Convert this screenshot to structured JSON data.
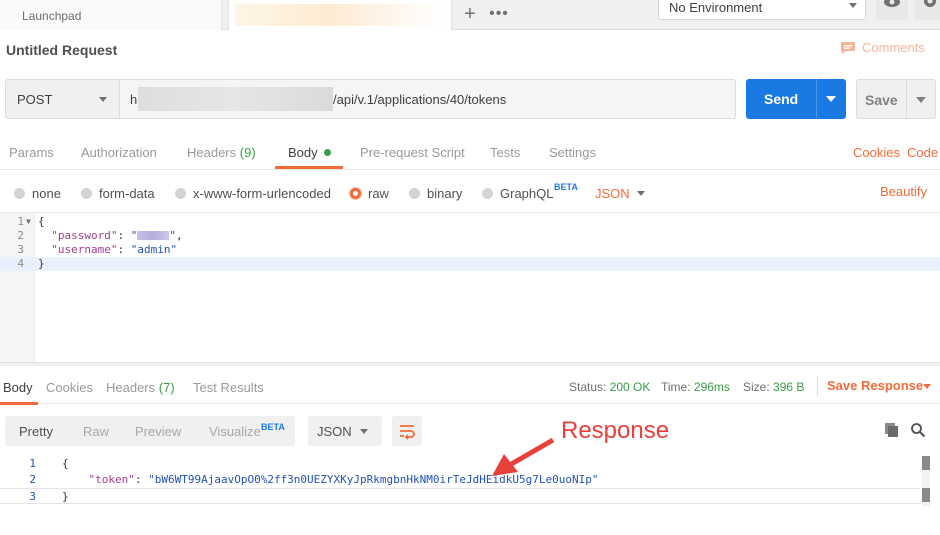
{
  "tabs": {
    "launchpad": "Launchpad",
    "add_symbol": "+",
    "more_symbol": "•••"
  },
  "environment": {
    "selected": "No Environment"
  },
  "request": {
    "title": "Untitled Request",
    "comments_label": "Comments",
    "method": "POST",
    "url_prefix": "h",
    "url_suffix": "/api/v.1/applications/40/tokens",
    "send_label": "Send",
    "save_label": "Save"
  },
  "request_tabs": [
    {
      "label": "Params"
    },
    {
      "label": "Authorization"
    },
    {
      "label": "Headers",
      "count": "(9)"
    },
    {
      "label": "Body"
    },
    {
      "label": "Pre-request Script"
    },
    {
      "label": "Tests"
    },
    {
      "label": "Settings"
    }
  ],
  "request_links": {
    "cookies": "Cookies",
    "code": "Code"
  },
  "body_types": {
    "options": [
      "none",
      "form-data",
      "x-www-form-urlencoded",
      "raw",
      "binary",
      "GraphQL"
    ],
    "selected": "raw",
    "beta": "BETA",
    "format": "JSON",
    "beautify": "Beautify"
  },
  "request_body": {
    "line_numbers": [
      "1",
      "2",
      "3",
      "4"
    ],
    "open_brace": "{",
    "password_key": "\"password\"",
    "username_key": "\"username\"",
    "username_value": "\"admin\"",
    "close_brace": "}"
  },
  "response_tabs": [
    {
      "label": "Body"
    },
    {
      "label": "Cookies"
    },
    {
      "label": "Headers",
      "count": "(7)"
    },
    {
      "label": "Test Results"
    }
  ],
  "response_status": {
    "status_label": "Status:",
    "status_value": "200 OK",
    "time_label": "Time:",
    "time_value": "296ms",
    "size_label": "Size:",
    "size_value": "396 B",
    "save_response": "Save Response"
  },
  "response_view": {
    "tabs": [
      "Pretty",
      "Raw",
      "Preview",
      "Visualize"
    ],
    "beta": "BETA",
    "format": "JSON"
  },
  "annotation": {
    "label": "Response",
    "color": "#e8403a"
  },
  "response_body": {
    "line_numbers": [
      "1",
      "2",
      "3"
    ],
    "open_brace": "{",
    "token_key": "\"token\"",
    "token_value": "\"bW6WT99AjaavOpO0%2ff3n0UEZYXKyJpRkmgbnHkNM0irTeJdHEidkU5g7Le0uoNIp\"",
    "close_brace": "}"
  },
  "colors": {
    "accent_orange": "#f26b3a",
    "send_blue": "#1a7ae3",
    "status_green": "#3a9c48"
  }
}
